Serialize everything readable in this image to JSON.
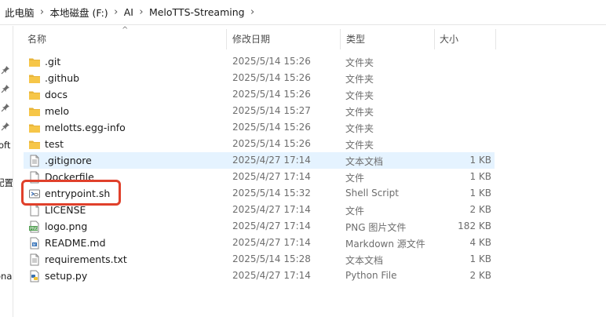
{
  "breadcrumb": [
    "此电脑",
    "本地磁盘 (F:)",
    "AI",
    "MeloTTS-Streaming"
  ],
  "columns": {
    "name": "名称",
    "modified": "修改日期",
    "type": "类型",
    "size": "大小"
  },
  "nav_fragments": [
    "oft",
    "配置",
    "ona"
  ],
  "files": [
    {
      "name": ".git",
      "modified": "2025/5/14 15:26",
      "type": "文件夹",
      "size": "",
      "icon": "folder-icon"
    },
    {
      "name": ".github",
      "modified": "2025/5/14 15:26",
      "type": "文件夹",
      "size": "",
      "icon": "folder-icon"
    },
    {
      "name": "docs",
      "modified": "2025/5/14 15:26",
      "type": "文件夹",
      "size": "",
      "icon": "folder-icon"
    },
    {
      "name": "melo",
      "modified": "2025/5/14 15:27",
      "type": "文件夹",
      "size": "",
      "icon": "folder-icon"
    },
    {
      "name": "melotts.egg-info",
      "modified": "2025/5/14 15:26",
      "type": "文件夹",
      "size": "",
      "icon": "folder-icon"
    },
    {
      "name": "test",
      "modified": "2025/5/14 15:26",
      "type": "文件夹",
      "size": "",
      "icon": "folder-icon"
    },
    {
      "name": ".gitignore",
      "modified": "2025/4/27 17:14",
      "type": "文本文档",
      "size": "1 KB",
      "icon": "text-file-icon"
    },
    {
      "name": "Dockerfile",
      "modified": "2025/4/27 17:14",
      "type": "文件",
      "size": "1 KB",
      "icon": "blank-file-icon"
    },
    {
      "name": "entrypoint.sh",
      "modified": "2025/5/14 15:32",
      "type": "Shell Script",
      "size": "1 KB",
      "icon": "shell-script-icon"
    },
    {
      "name": "LICENSE",
      "modified": "2025/4/27 17:14",
      "type": "文件",
      "size": "2 KB",
      "icon": "blank-file-icon"
    },
    {
      "name": "logo.png",
      "modified": "2025/4/27 17:14",
      "type": "PNG 图片文件",
      "size": "182 KB",
      "icon": "png-image-icon"
    },
    {
      "name": "README.md",
      "modified": "2025/4/27 17:14",
      "type": "Markdown 源文件",
      "size": "4 KB",
      "icon": "markdown-file-icon"
    },
    {
      "name": "requirements.txt",
      "modified": "2025/5/14 15:28",
      "type": "文本文档",
      "size": "1 KB",
      "icon": "text-file-icon"
    },
    {
      "name": "setup.py",
      "modified": "2025/4/27 17:14",
      "type": "Python File",
      "size": "2 KB",
      "icon": "python-file-icon"
    }
  ],
  "selected_file": ".gitignore",
  "highlighted_file": "entrypoint.sh",
  "colors": {
    "folder": "#f6c648",
    "selection": "#e5f3ff",
    "highlight": "#e0402b"
  }
}
